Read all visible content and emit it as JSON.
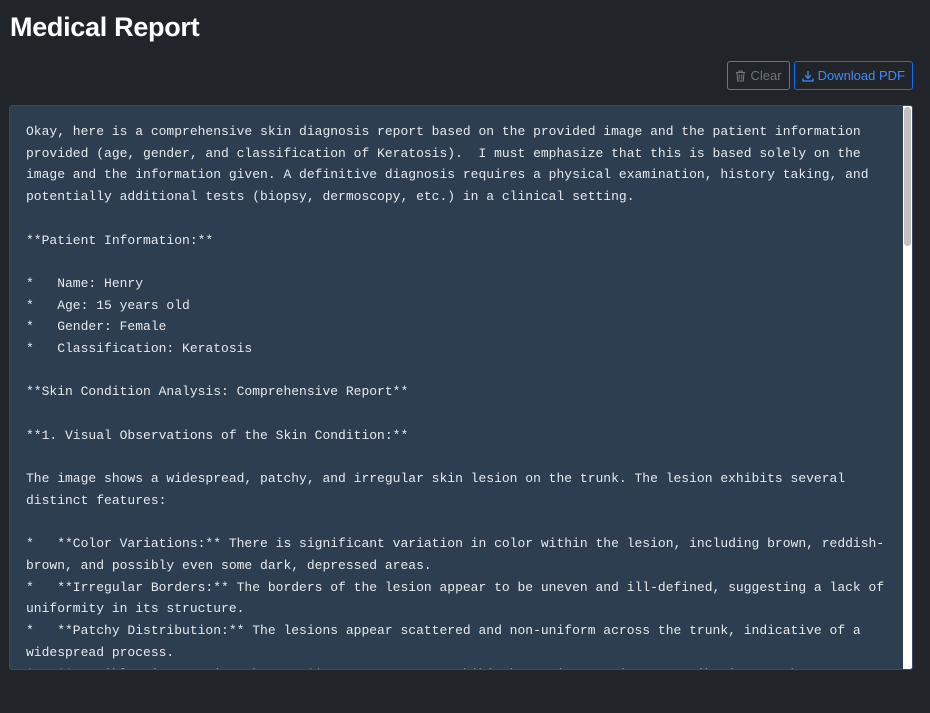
{
  "header": {
    "title": "Medical Report"
  },
  "toolbar": {
    "clear_label": "Clear",
    "clear_icon": "trash-icon",
    "download_label": "Download PDF",
    "download_icon": "download-icon"
  },
  "report": {
    "text": "Okay, here is a comprehensive skin diagnosis report based on the provided image and the patient information provided (age, gender, and classification of Keratosis).  I must emphasize that this is based solely on the image and the information given. A definitive diagnosis requires a physical examination, history taking, and potentially additional tests (biopsy, dermoscopy, etc.) in a clinical setting.\n\n**Patient Information:**\n\n*   Name: Henry\n*   Age: 15 years old\n*   Gender: Female\n*   Classification: Keratosis\n\n**Skin Condition Analysis: Comprehensive Report**\n\n**1. Visual Observations of the Skin Condition:**\n\nThe image shows a widespread, patchy, and irregular skin lesion on the trunk. The lesion exhibits several distinct features:\n\n*   **Color Variations:** There is significant variation in color within the lesion, including brown, reddish-brown, and possibly even some dark, depressed areas.\n*   **Irregular Borders:** The borders of the lesion appear to be uneven and ill-defined, suggesting a lack of uniformity in its structure.\n*   **Patchy Distribution:** The lesions appear scattered and non-uniform across the trunk, indicative of a widespread process.\n*   **Possible Pigmentation Changes:** Some areas may exhibit hyperpigmentation, contributing to the"
  },
  "colors": {
    "background": "#212529",
    "panel": "#2c3e50",
    "primary": "#0d6efd",
    "secondary": "#6c757d"
  }
}
